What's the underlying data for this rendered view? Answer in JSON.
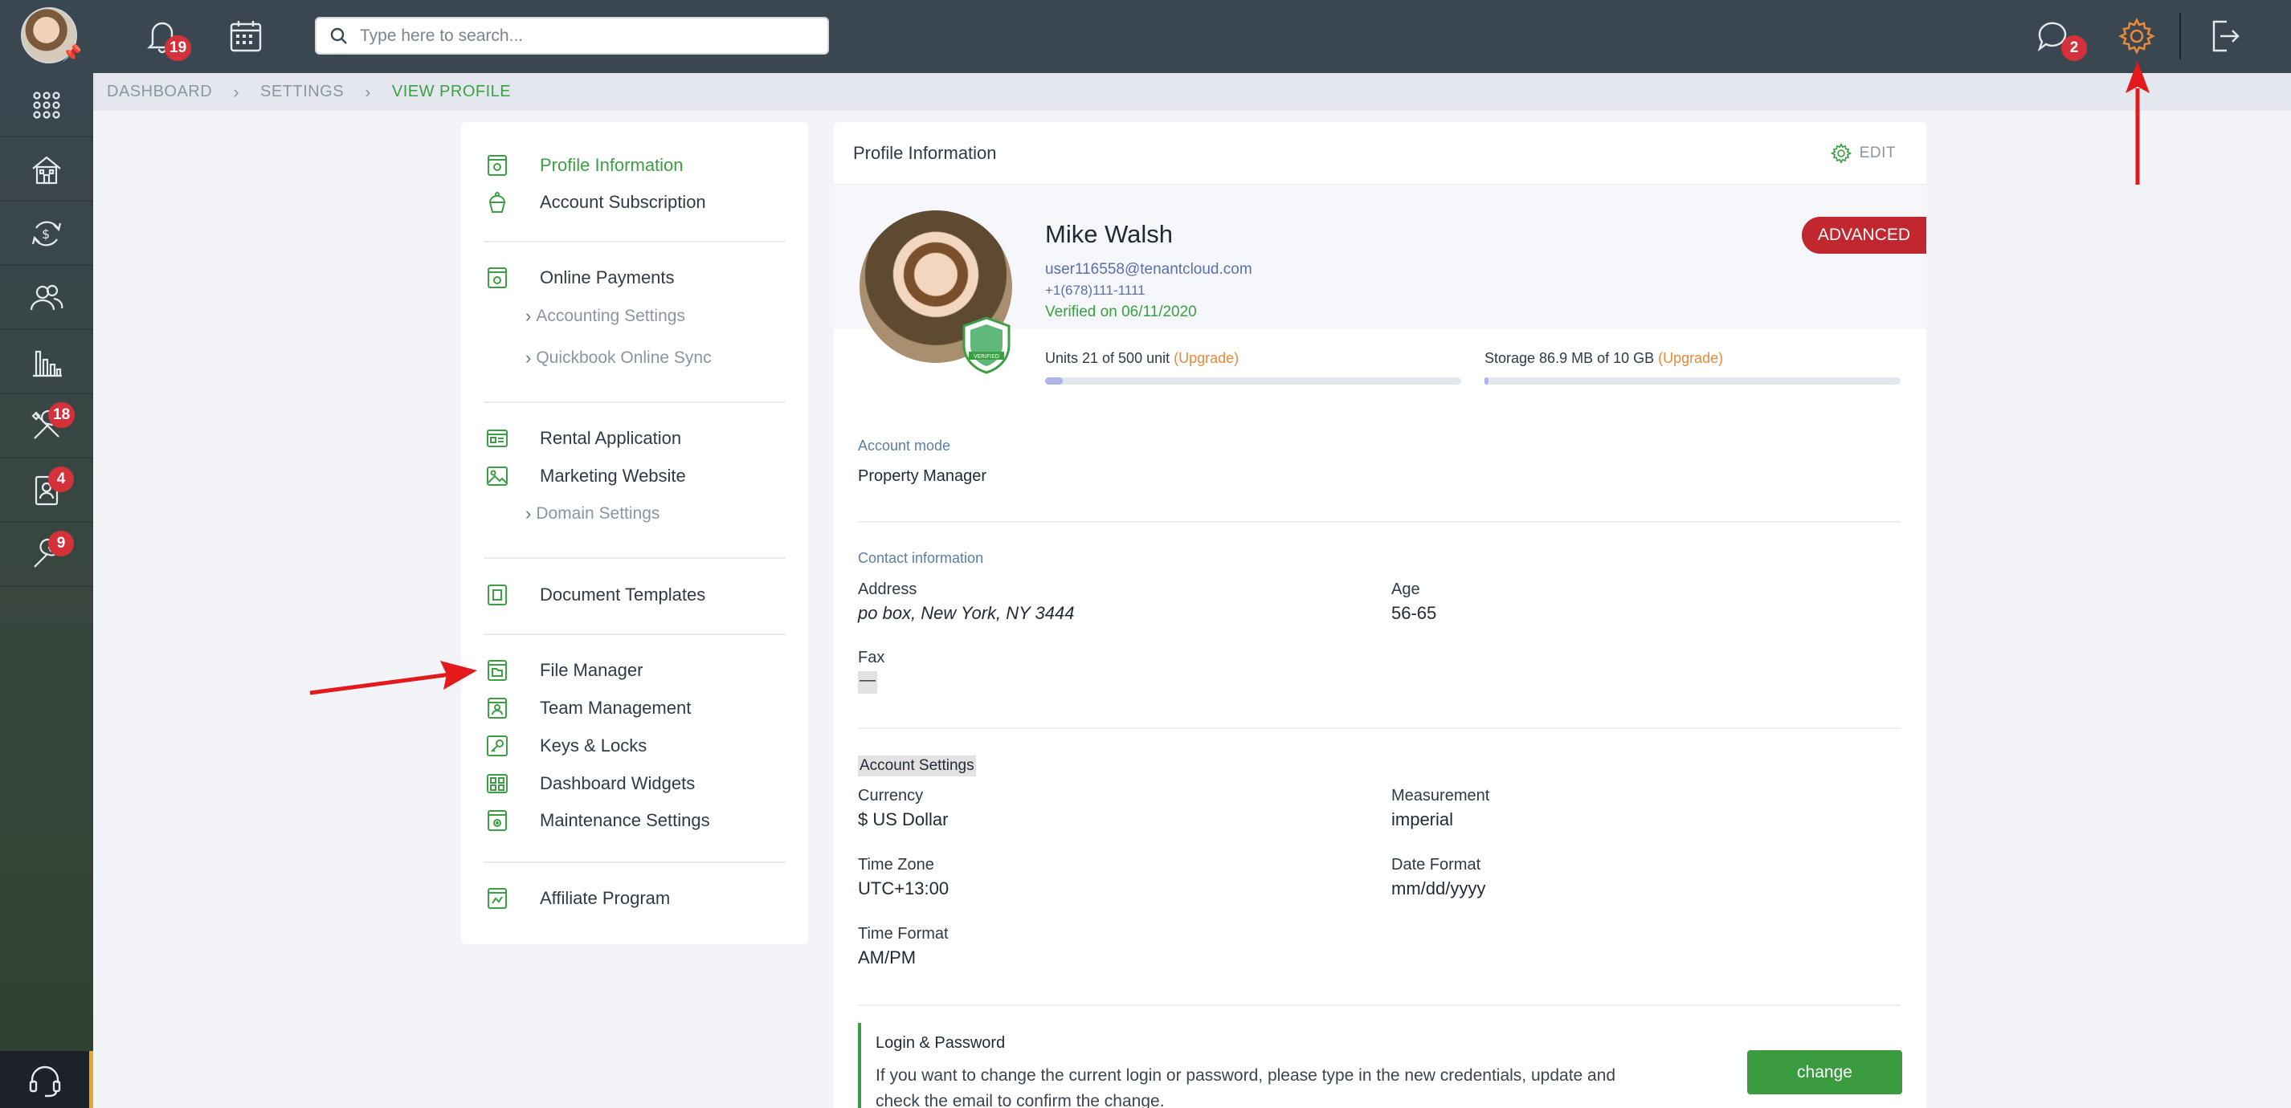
{
  "topbar": {
    "search_placeholder": "Type here to search...",
    "notifications_count": "19",
    "messages_count": "2"
  },
  "leftnav": {
    "items": [
      {
        "name": "apps",
        "badge": ""
      },
      {
        "name": "properties",
        "badge": ""
      },
      {
        "name": "payments",
        "badge": ""
      },
      {
        "name": "people",
        "badge": ""
      },
      {
        "name": "reports",
        "badge": ""
      },
      {
        "name": "maintenance",
        "badge": "18"
      },
      {
        "name": "applications",
        "badge": "4"
      },
      {
        "name": "tools",
        "badge": "9"
      }
    ]
  },
  "breadcrumb": {
    "items": [
      "DASHBOARD",
      "SETTINGS",
      "VIEW PROFILE"
    ]
  },
  "menu": {
    "profile_information": "Profile Information",
    "account_subscription": "Account Subscription",
    "online_payments": "Online Payments",
    "accounting_settings": "Accounting Settings",
    "quickbook_sync": "Quickbook Online Sync",
    "rental_application": "Rental Application",
    "marketing_website": "Marketing Website",
    "domain_settings": "Domain Settings",
    "document_templates": "Document Templates",
    "file_manager": "File Manager",
    "team_management": "Team Management",
    "keys_locks": "Keys & Locks",
    "dashboard_widgets": "Dashboard Widgets",
    "maintenance_settings": "Maintenance Settings",
    "affiliate_program": "Affiliate Program"
  },
  "profile": {
    "card_title": "Profile Information",
    "edit_label": "EDIT",
    "name": "Mike Walsh",
    "email": "user116558@tenantcloud.com",
    "phone": "+1(678)111-1111",
    "verified": "Verified on 06/11/2020",
    "plan_badge": "ADVANCED",
    "units_text": "Units 21 of 500 unit ",
    "units_fraction": 0.042,
    "storage_text": "Storage 86.9 MB of 10 GB ",
    "storage_fraction": 0.009,
    "upgrade_label": "(Upgrade)",
    "verified_shield_text": "VERIFIED"
  },
  "account_mode": {
    "label": "Account mode",
    "value": "Property Manager"
  },
  "contact": {
    "label": "Contact information",
    "address_label": "Address",
    "address_value": "po box, New York, NY 3444",
    "age_label": "Age",
    "age_value": "56-65",
    "fax_label": "Fax",
    "fax_value": "—"
  },
  "account_settings": {
    "label": "Account Settings",
    "currency_label": "Currency",
    "currency_value": "$ US Dollar",
    "measurement_label": "Measurement",
    "measurement_value": "imperial",
    "timezone_label": "Time Zone",
    "timezone_value": "UTC+13:00",
    "dateformat_label": "Date Format",
    "dateformat_value": "mm/dd/yyyy",
    "timeformat_label": "Time Format",
    "timeformat_value": "AM/PM"
  },
  "login": {
    "title": "Login & Password",
    "text": "If you want to change the current login or password, please type in the new credentials, update and check the email to confirm the change.",
    "button": "change"
  },
  "colors": {
    "accent_green": "#3aa043",
    "badge_red": "#d4313a",
    "upgrade_orange": "#e7893a",
    "annotation_red": "#e3191b"
  }
}
